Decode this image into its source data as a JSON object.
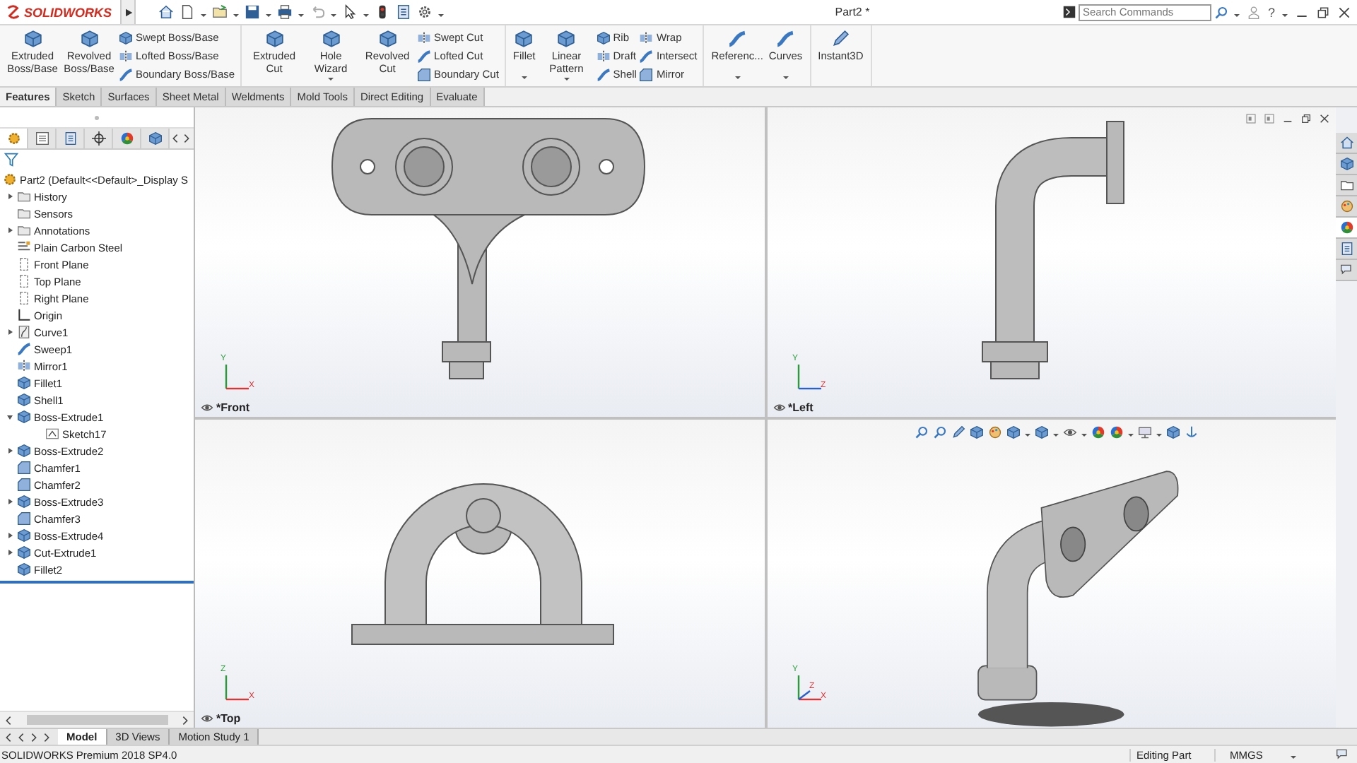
{
  "title_bar": {
    "logo": "SOLIDWORKS",
    "document_title": "Part2 *",
    "search": {
      "placeholder": "Search Commands"
    },
    "help": "?"
  },
  "ribbon": [
    {
      "items": [
        {
          "kind": "large",
          "label": "Extruded Boss/Base",
          "dropdown": false
        },
        {
          "kind": "large",
          "label": "Revolved Boss/Base",
          "dropdown": false
        },
        {
          "kind": "stack",
          "labels": [
            "Swept Boss/Base",
            "Lofted Boss/Base",
            "Boundary Boss/Base"
          ]
        }
      ]
    },
    {
      "items": [
        {
          "kind": "large",
          "label": "Extruded Cut",
          "dropdown": false
        },
        {
          "kind": "large",
          "label": "Hole Wizard",
          "dropdown": true
        },
        {
          "kind": "large",
          "label": "Revolved Cut",
          "dropdown": false
        },
        {
          "kind": "stack",
          "labels": [
            "Swept Cut",
            "Lofted Cut",
            "Boundary Cut"
          ]
        }
      ]
    },
    {
      "items": [
        {
          "kind": "large",
          "label": "Fillet",
          "dropdown": true
        },
        {
          "kind": "large",
          "label": "Linear Pattern",
          "dropdown": true
        },
        {
          "kind": "stack",
          "labels": [
            "Rib",
            "Draft",
            "Shell"
          ]
        },
        {
          "kind": "stack",
          "labels": [
            "Wrap",
            "Intersect",
            "Mirror"
          ]
        }
      ]
    },
    {
      "items": [
        {
          "kind": "large",
          "label": "Referenc...",
          "dropdown": true
        },
        {
          "kind": "large",
          "label": "Curves",
          "dropdown": true
        }
      ]
    },
    {
      "items": [
        {
          "kind": "large",
          "label": "Instant3D",
          "dropdown": false
        }
      ]
    }
  ],
  "command_tabs": [
    {
      "label": "Features",
      "selected": true
    },
    {
      "label": "Sketch",
      "selected": false
    },
    {
      "label": "Surfaces",
      "selected": false
    },
    {
      "label": "Sheet Metal",
      "selected": false
    },
    {
      "label": "Weldments",
      "selected": false
    },
    {
      "label": "Mold Tools",
      "selected": false
    },
    {
      "label": "Direct Editing",
      "selected": false
    },
    {
      "label": "Evaluate",
      "selected": false
    }
  ],
  "panel_tabs": [
    {
      "selected": true
    },
    {
      "selected": false
    },
    {
      "selected": false
    },
    {
      "selected": false
    },
    {
      "selected": false
    },
    {
      "selected": false
    }
  ],
  "feature_tree": {
    "root": "Part2  (Default<<Default>_Display S",
    "items": [
      {
        "label": "History",
        "kind": "folder",
        "expanded": false
      },
      {
        "label": "Sensors",
        "kind": "folder"
      },
      {
        "label": "Annotations",
        "kind": "folder",
        "expanded": false
      },
      {
        "label": "Plain Carbon Steel",
        "kind": "material"
      },
      {
        "label": "Front Plane",
        "kind": "plane"
      },
      {
        "label": "Top Plane",
        "kind": "plane"
      },
      {
        "label": "Right Plane",
        "kind": "plane"
      },
      {
        "label": "Origin",
        "kind": "origin"
      },
      {
        "label": "Curve1",
        "kind": "curve",
        "expanded": false
      },
      {
        "label": "Sweep1",
        "kind": "sweep"
      },
      {
        "label": "Mirror1",
        "kind": "mirror"
      },
      {
        "label": "Fillet1",
        "kind": "feature"
      },
      {
        "label": "Shell1",
        "kind": "feature"
      },
      {
        "label": "Boss-Extrude1",
        "kind": "feature",
        "expanded": true,
        "children": [
          {
            "label": "Sketch17",
            "kind": "sketch"
          }
        ]
      },
      {
        "label": "Boss-Extrude2",
        "kind": "feature",
        "expanded": false
      },
      {
        "label": "Chamfer1",
        "kind": "chamfer"
      },
      {
        "label": "Chamfer2",
        "kind": "chamfer"
      },
      {
        "label": "Boss-Extrude3",
        "kind": "feature",
        "expanded": false
      },
      {
        "label": "Chamfer3",
        "kind": "chamfer"
      },
      {
        "label": "Boss-Extrude4",
        "kind": "feature",
        "expanded": false
      },
      {
        "label": "Cut-Extrude1",
        "kind": "feature",
        "expanded": false
      },
      {
        "label": "Fillet2",
        "kind": "feature"
      }
    ]
  },
  "viewports": [
    {
      "kind": "front",
      "label": "*Front",
      "axes": [
        "Y",
        "X"
      ]
    },
    {
      "kind": "left",
      "label": "*Left",
      "axes": [
        "Y",
        "Z"
      ]
    },
    {
      "kind": "top",
      "label": "*Top",
      "axes": [
        "Z",
        "X"
      ]
    },
    {
      "kind": "iso",
      "axes": [
        "Y",
        "X",
        "Z"
      ]
    }
  ],
  "task_pane": [
    {
      "selected": false
    },
    {
      "selected": false
    },
    {
      "selected": false
    },
    {
      "selected": false
    },
    {
      "selected": true
    },
    {
      "selected": false
    },
    {
      "selected": false
    }
  ],
  "bottom_tabs": [
    {
      "label": "Model",
      "selected": true
    },
    {
      "label": "3D Views",
      "selected": false
    },
    {
      "label": "Motion Study 1",
      "selected": false
    }
  ],
  "status_bar": {
    "product": "SOLIDWORKS Premium 2018 SP4.0",
    "mode": "Editing Part",
    "units": "MMGS"
  }
}
